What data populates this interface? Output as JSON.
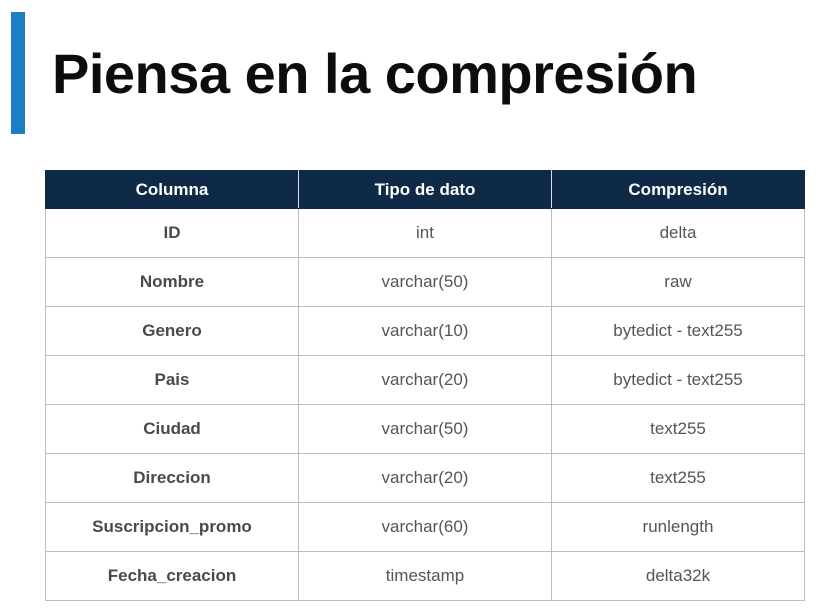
{
  "slide": {
    "title": "Piensa en la compresión",
    "accent_color": "#1a7fc4"
  },
  "table": {
    "header_color": "#0f2a47",
    "headers": [
      "Columna",
      "Tipo de dato",
      "Compresión"
    ],
    "rows": [
      [
        "ID",
        "int",
        "delta"
      ],
      [
        "Nombre",
        "varchar(50)",
        "raw"
      ],
      [
        "Genero",
        "varchar(10)",
        "bytedict - text255"
      ],
      [
        "Pais",
        "varchar(20)",
        "bytedict - text255"
      ],
      [
        "Ciudad",
        "varchar(50)",
        "text255"
      ],
      [
        "Direccion",
        "varchar(20)",
        "text255"
      ],
      [
        "Suscripcion_promo",
        "varchar(60)",
        "runlength"
      ],
      [
        "Fecha_creacion",
        "timestamp",
        "delta32k"
      ]
    ]
  }
}
